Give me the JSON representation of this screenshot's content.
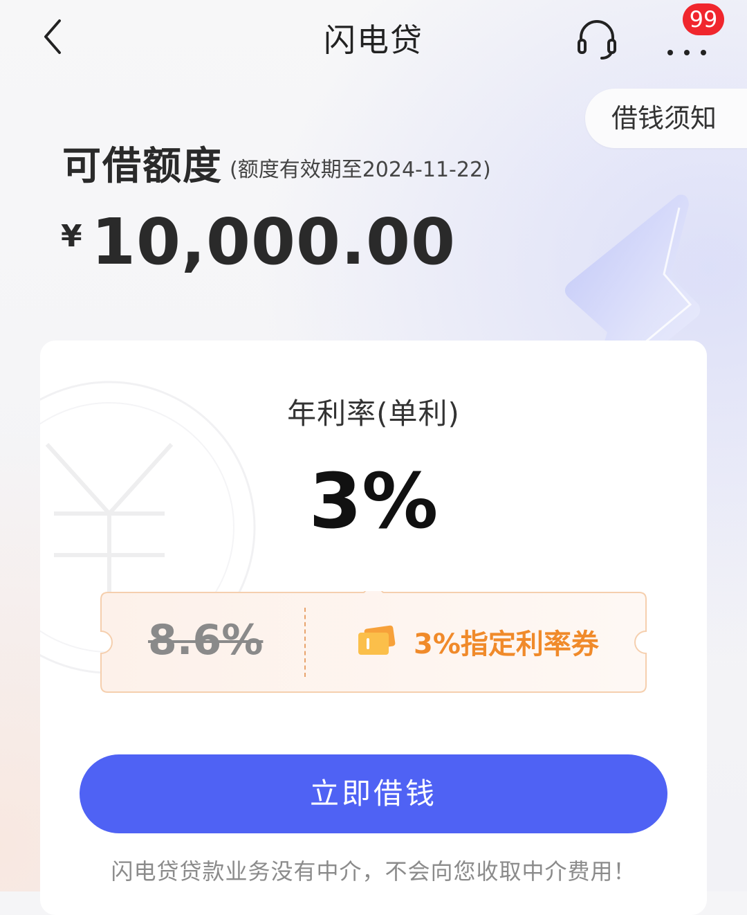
{
  "header": {
    "title": "闪电贷",
    "badge_count": "99",
    "icons": {
      "back": "chevron-left-icon",
      "service": "headset-icon",
      "more": "more-dots-icon"
    }
  },
  "notice": {
    "label": "借钱须知"
  },
  "quota": {
    "label": "可借额度",
    "expiry": "(额度有效期至2024-11-22)",
    "currency": "¥",
    "amount": "10,000.00"
  },
  "rate": {
    "label": "年利率(单利)",
    "value": "3%",
    "original": "8.6%",
    "coupon_label": "3%指定利率券",
    "coupon_icon": "ticket-icon"
  },
  "actions": {
    "borrow_label": "立即借钱"
  },
  "disclaimer": "闪电贷贷款业务没有中介，不会向您收取中介费用！",
  "colors": {
    "primary": "#4f62f4",
    "badge": "#f0262d",
    "coupon_accent": "#f08a2a"
  }
}
